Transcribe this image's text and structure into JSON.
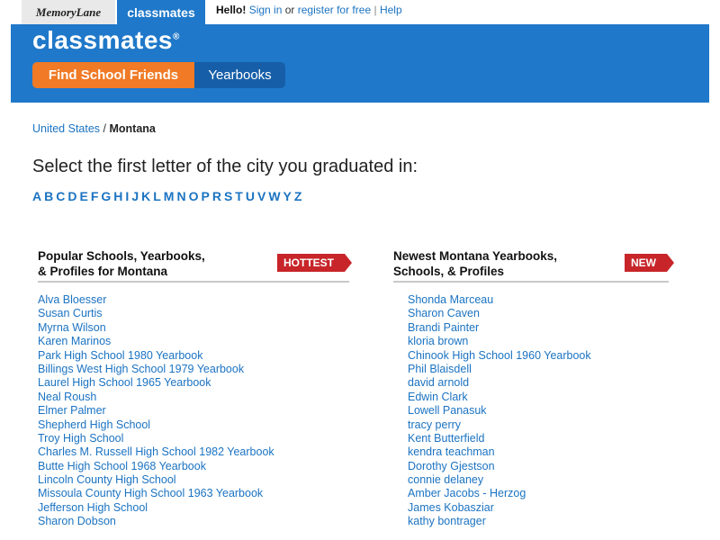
{
  "topbar": {
    "memorylane_label": "MemoryLane",
    "classmates_tab_label": "classmates",
    "hello_label": "Hello!",
    "signin_label": "Sign in",
    "or_label": "or",
    "register_label": "register for free",
    "separator": "|",
    "help_label": "Help"
  },
  "header": {
    "logo": "classmates",
    "find_friends_label": "Find School Friends",
    "yearbooks_label": "Yearbooks"
  },
  "breadcrumb": {
    "country": "United States",
    "sep": "/",
    "state": "Montana"
  },
  "prompt": "Select the first letter of the city you graduated in:",
  "letters": [
    "A",
    "B",
    "C",
    "D",
    "E",
    "F",
    "G",
    "H",
    "I",
    "J",
    "K",
    "L",
    "M",
    "N",
    "O",
    "P",
    "R",
    "S",
    "T",
    "U",
    "V",
    "W",
    "Y",
    "Z"
  ],
  "popular": {
    "title_line1": "Popular Schools, Yearbooks,",
    "title_line2": "& Profiles for Montana",
    "badge": "HOTTEST",
    "items": [
      "Alva Bloesser",
      "Susan Curtis",
      "Myrna Wilson",
      "Karen Marinos",
      "Park High School 1980 Yearbook",
      "Billings West High School 1979 Yearbook",
      "Laurel High School 1965 Yearbook",
      "Neal Roush",
      "Elmer Palmer",
      "Shepherd High School",
      "Troy High School",
      "Charles M. Russell High School 1982 Yearbook",
      "Butte High School 1968 Yearbook",
      "Lincoln County High School",
      "Missoula County High School 1963 Yearbook",
      "Jefferson High School",
      "Sharon Dobson"
    ]
  },
  "newest": {
    "title_line1": "Newest Montana Yearbooks,",
    "title_line2": "Schools, & Profiles",
    "badge": "NEW",
    "items": [
      "Shonda Marceau",
      "Sharon Caven",
      "Brandi Painter",
      "kloria brown",
      "Chinook High School 1960 Yearbook",
      "Phil Blaisdell",
      "david arnold",
      "Edwin Clark",
      "Lowell Panasuk",
      "tracy perry",
      "Kent Butterfield",
      "kendra teachman",
      "Dorothy Gjestson",
      "connie delaney",
      "Amber Jacobs - Herzog",
      "James Kobasziar",
      "kathy bontrager"
    ]
  },
  "colors": {
    "brand_blue": "#1f78c9",
    "orange": "#f07a25",
    "dark_blue": "#165fa8",
    "link": "#1b73c2",
    "ribbon_red": "#c7252a"
  }
}
